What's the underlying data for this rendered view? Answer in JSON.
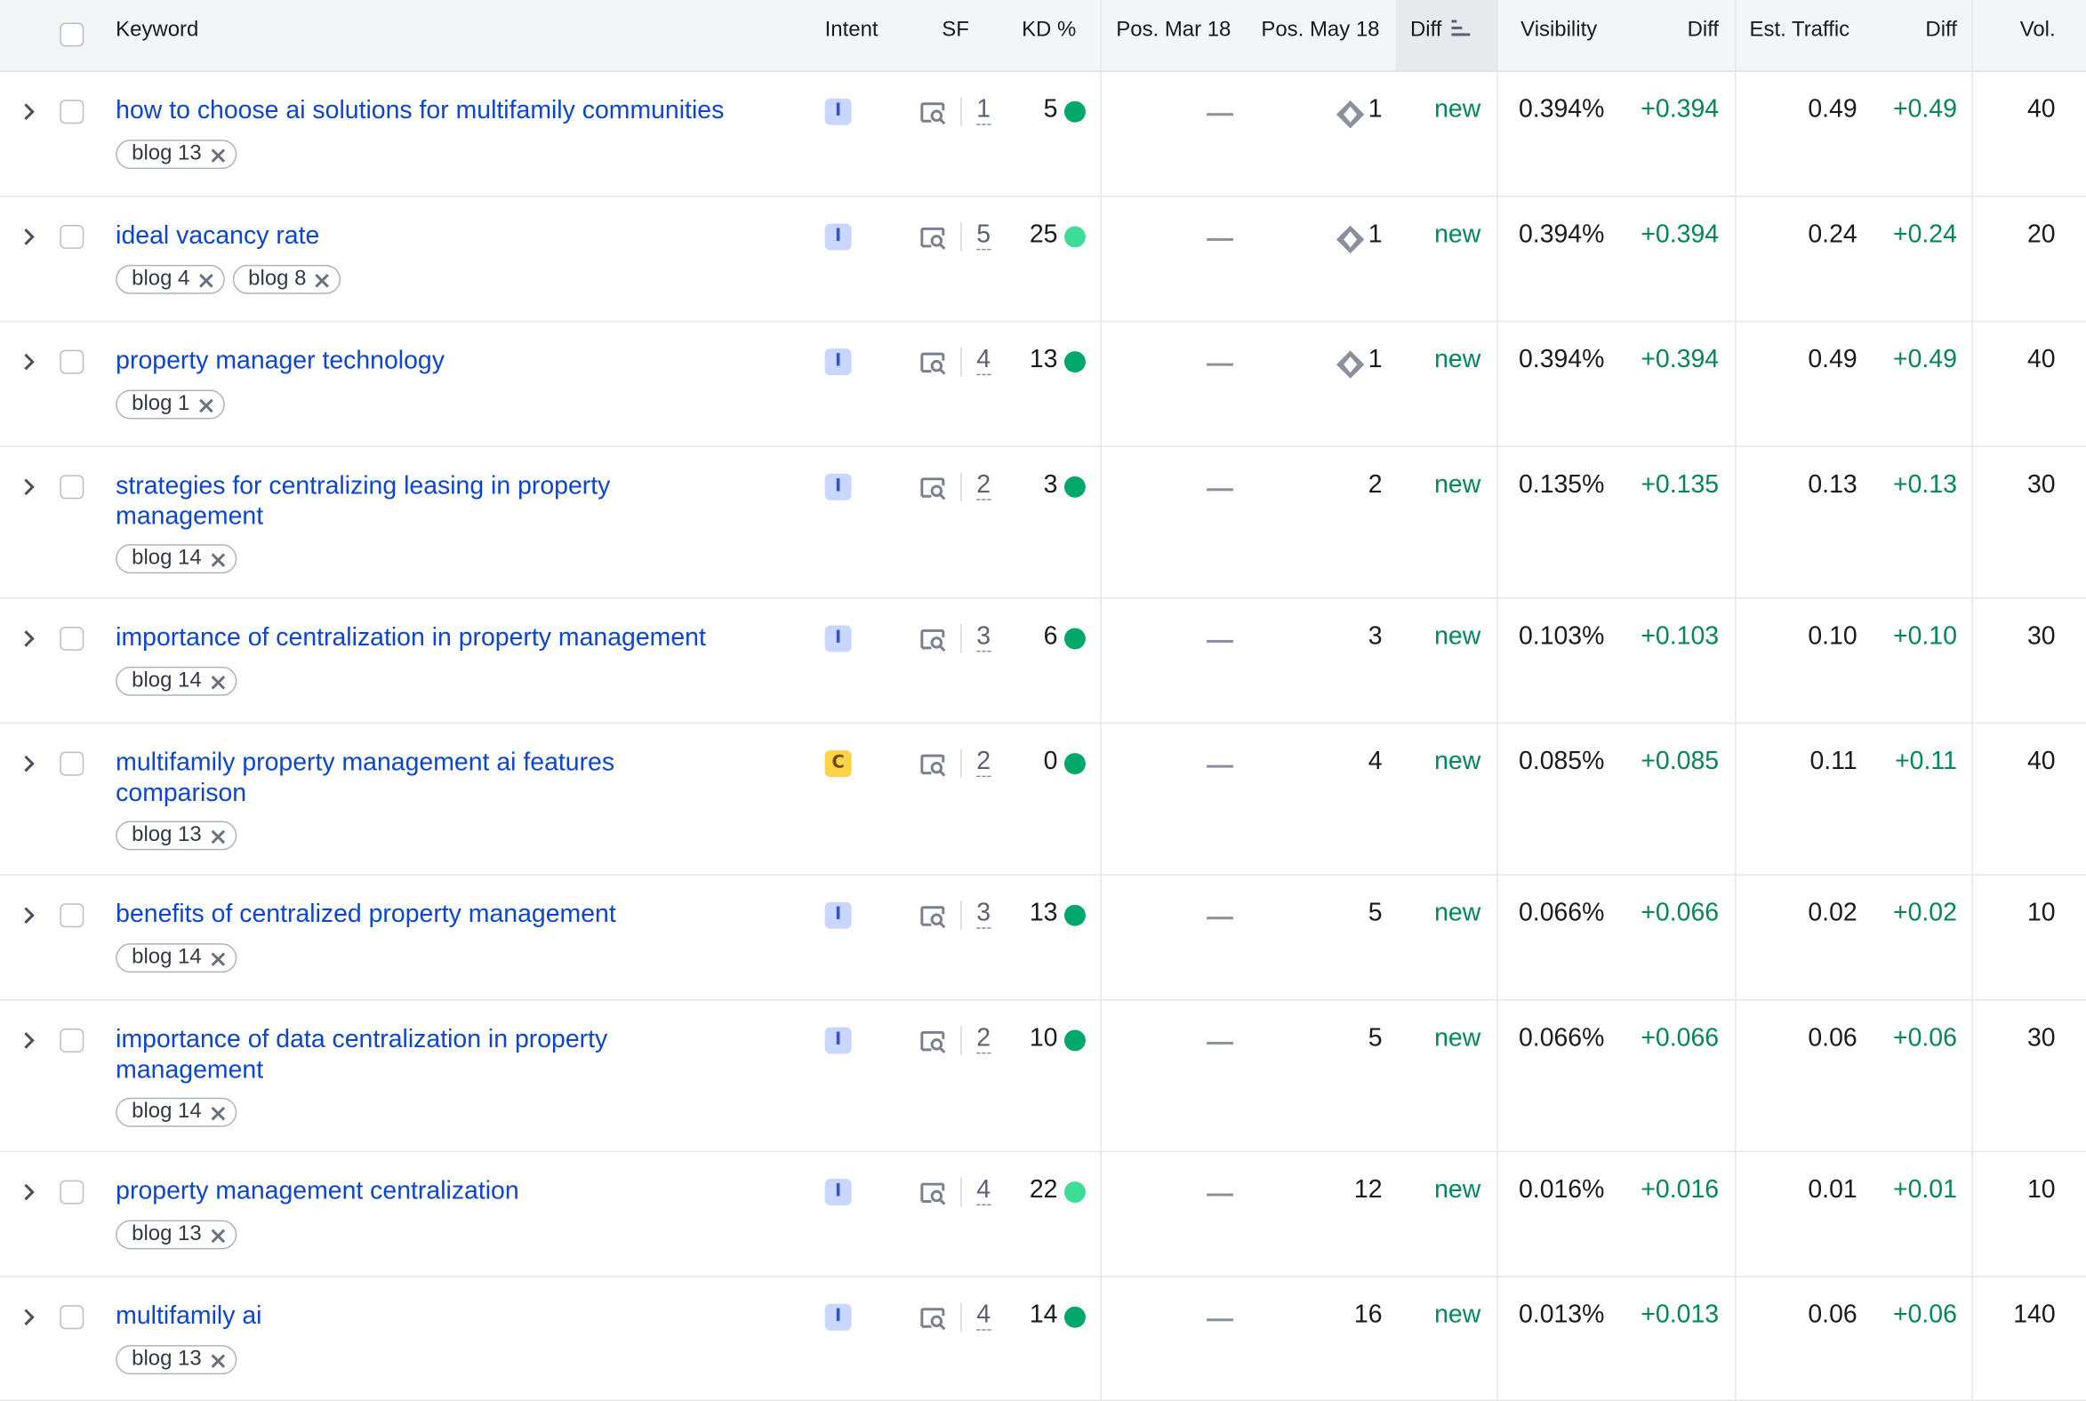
{
  "header": {
    "keyword": "Keyword",
    "intent": "Intent",
    "sf": "SF",
    "kd": "KD %",
    "pos_prev": "Pos. Mar 18",
    "pos_curr": "Pos. May 18",
    "diff": "Diff",
    "visibility": "Visibility",
    "vis_diff": "Diff",
    "traffic": "Est. Traffic",
    "traffic_diff": "Diff",
    "volume": "Vol."
  },
  "colors": {
    "link": "#0b45d6",
    "positive": "#00875a",
    "kd_easy": "#00a86b",
    "kd_very_easy": "#3ddc97",
    "intent_informational": "#c9d6ff",
    "intent_commercial": "#ffd24a"
  },
  "icons": {
    "expand": "chevron-right-icon",
    "serp": "serp-features-icon",
    "remove_tag": "close-icon",
    "position_feature": "featured-snippet-icon",
    "sort": "sort-descending-icon"
  },
  "rows": [
    {
      "keyword": "how to choose ai solutions for multifamily communities",
      "tags": [
        "blog 13"
      ],
      "intent": "I",
      "sf": "1",
      "kd": "5",
      "kd_level": "easy",
      "pos_prev": "",
      "pos_curr": "1",
      "feature": true,
      "diff": "new",
      "visibility": "0.394%",
      "vis_diff": "+0.394",
      "traffic": "0.49",
      "traffic_diff": "+0.49",
      "volume": "40"
    },
    {
      "keyword": "ideal vacancy rate",
      "tags": [
        "blog 4",
        "blog 8"
      ],
      "intent": "I",
      "sf": "5",
      "kd": "25",
      "kd_level": "very_easy",
      "pos_prev": "",
      "pos_curr": "1",
      "feature": true,
      "diff": "new",
      "visibility": "0.394%",
      "vis_diff": "+0.394",
      "traffic": "0.24",
      "traffic_diff": "+0.24",
      "volume": "20"
    },
    {
      "keyword": "property manager technology",
      "tags": [
        "blog 1"
      ],
      "intent": "I",
      "sf": "4",
      "kd": "13",
      "kd_level": "easy",
      "pos_prev": "",
      "pos_curr": "1",
      "feature": true,
      "diff": "new",
      "visibility": "0.394%",
      "vis_diff": "+0.394",
      "traffic": "0.49",
      "traffic_diff": "+0.49",
      "volume": "40"
    },
    {
      "keyword": "strategies for centralizing leasing in property management",
      "tags": [
        "blog 14"
      ],
      "intent": "I",
      "sf": "2",
      "kd": "3",
      "kd_level": "easy",
      "pos_prev": "",
      "pos_curr": "2",
      "feature": false,
      "diff": "new",
      "visibility": "0.135%",
      "vis_diff": "+0.135",
      "traffic": "0.13",
      "traffic_diff": "+0.13",
      "volume": "30"
    },
    {
      "keyword": "importance of centralization in property management",
      "tags": [
        "blog 14"
      ],
      "intent": "I",
      "sf": "3",
      "kd": "6",
      "kd_level": "easy",
      "pos_prev": "",
      "pos_curr": "3",
      "feature": false,
      "diff": "new",
      "visibility": "0.103%",
      "vis_diff": "+0.103",
      "traffic": "0.10",
      "traffic_diff": "+0.10",
      "volume": "30"
    },
    {
      "keyword": "multifamily property management ai features comparison",
      "tags": [
        "blog 13"
      ],
      "intent": "C",
      "sf": "2",
      "kd": "0",
      "kd_level": "easy",
      "pos_prev": "",
      "pos_curr": "4",
      "feature": false,
      "diff": "new",
      "visibility": "0.085%",
      "vis_diff": "+0.085",
      "traffic": "0.11",
      "traffic_diff": "+0.11",
      "volume": "40"
    },
    {
      "keyword": "benefits of centralized property management",
      "tags": [
        "blog 14"
      ],
      "intent": "I",
      "sf": "3",
      "kd": "13",
      "kd_level": "easy",
      "pos_prev": "",
      "pos_curr": "5",
      "feature": false,
      "diff": "new",
      "visibility": "0.066%",
      "vis_diff": "+0.066",
      "traffic": "0.02",
      "traffic_diff": "+0.02",
      "volume": "10"
    },
    {
      "keyword": "importance of data centralization in property management",
      "tags": [
        "blog 14"
      ],
      "intent": "I",
      "sf": "2",
      "kd": "10",
      "kd_level": "easy",
      "pos_prev": "",
      "pos_curr": "5",
      "feature": false,
      "diff": "new",
      "visibility": "0.066%",
      "vis_diff": "+0.066",
      "traffic": "0.06",
      "traffic_diff": "+0.06",
      "volume": "30"
    },
    {
      "keyword": "property management centralization",
      "tags": [
        "blog 13"
      ],
      "intent": "I",
      "sf": "4",
      "kd": "22",
      "kd_level": "very_easy",
      "pos_prev": "",
      "pos_curr": "12",
      "feature": false,
      "diff": "new",
      "visibility": "0.016%",
      "vis_diff": "+0.016",
      "traffic": "0.01",
      "traffic_diff": "+0.01",
      "volume": "10"
    },
    {
      "keyword": "multifamily ai",
      "tags": [
        "blog 13"
      ],
      "intent": "I",
      "sf": "4",
      "kd": "14",
      "kd_level": "easy",
      "pos_prev": "",
      "pos_curr": "16",
      "feature": false,
      "diff": "new",
      "visibility": "0.013%",
      "vis_diff": "+0.013",
      "traffic": "0.06",
      "traffic_diff": "+0.06",
      "volume": "140"
    }
  ]
}
